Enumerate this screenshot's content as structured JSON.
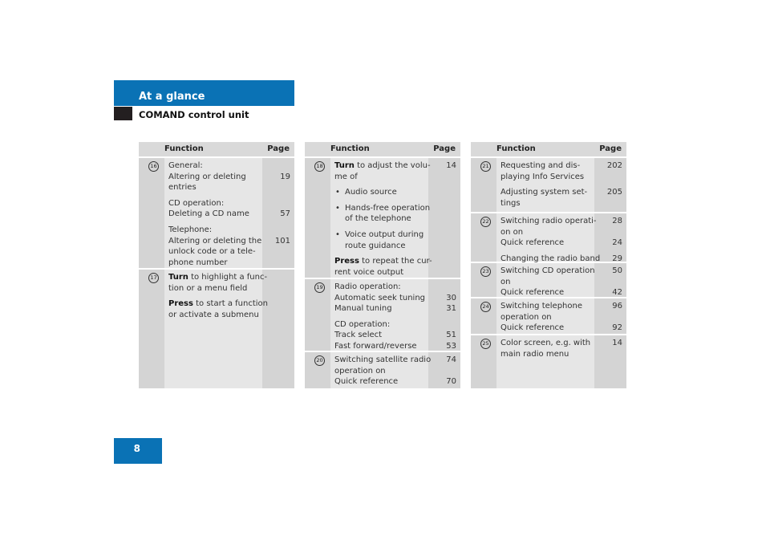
{
  "header": {
    "section": "At a glance",
    "subtitle": "COMAND control unit",
    "page_number": "8"
  },
  "tables": [
    {
      "head": {
        "function": "Function",
        "page": "Page"
      },
      "rows": [
        {
          "num": "16",
          "h": 137,
          "paras": [
            [
              {
                "t": "General:"
              },
              {
                "t": "Altering or deleting",
                "p": "19"
              },
              {
                "t": "entries"
              }
            ],
            [
              {
                "t": "CD operation:"
              },
              {
                "t": "Deleting a CD name",
                "p": "57"
              }
            ],
            [
              {
                "t": "Telephone:"
              },
              {
                "t": "Altering or deleting the",
                "p": "101"
              },
              {
                "t": "unlock code or a tele-"
              },
              {
                "t": "phone number"
              }
            ]
          ]
        },
        {
          "num": "17",
          "h": 148,
          "paras": [
            [
              {
                "b": "Turn",
                "t": " to highlight a func-"
              },
              {
                "t": "tion or a menu field"
              }
            ],
            [
              {
                "b": "Press",
                "t": " to start a function"
              },
              {
                "t": "or activate a submenu"
              }
            ]
          ]
        }
      ]
    },
    {
      "head": {
        "function": "Function",
        "page": "Page"
      },
      "rows": [
        {
          "num": "18",
          "h": 149,
          "paras": [
            [
              {
                "b": "Turn",
                "t": " to adjust the volu-",
                "p": "14"
              },
              {
                "t": "me of"
              }
            ],
            [
              {
                "t": "Audio source",
                "bullet": true
              }
            ],
            [
              {
                "t": "Hands-free operation",
                "bullet": true
              },
              {
                "t": "of the telephone",
                "cont": true
              }
            ],
            [
              {
                "t": "Voice output during",
                "bullet": true
              },
              {
                "t": "route guidance",
                "cont": true
              }
            ],
            [
              {
                "b": "Press",
                "t": " to repeat the cur-"
              },
              {
                "t": "rent voice output"
              }
            ]
          ]
        },
        {
          "num": "19",
          "h": 89,
          "paras": [
            [
              {
                "t": "Radio operation:"
              },
              {
                "t": "Automatic seek tuning",
                "p": "30"
              },
              {
                "t": "Manual tuning",
                "p": "31"
              }
            ],
            [
              {
                "t": "CD operation:"
              },
              {
                "t": "Track select",
                "p": "51"
              },
              {
                "t": "Fast forward/reverse",
                "p": "53"
              }
            ]
          ]
        },
        {
          "num": "20",
          "h": 45,
          "paras": [
            [
              {
                "t": "Switching satellite radio",
                "p": "74"
              },
              {
                "t": "operation on"
              },
              {
                "t": "Quick reference",
                "p": "70"
              }
            ]
          ]
        }
      ]
    },
    {
      "head": {
        "function": "Function",
        "page": "Page"
      },
      "rows": [
        {
          "num": "21",
          "h": 67,
          "paras": [
            [
              {
                "t": "Requesting and dis-",
                "p": "202"
              },
              {
                "t": "playing Info Services"
              }
            ],
            [
              {
                "t": "Adjusting system set-",
                "p": "205"
              },
              {
                "t": "tings"
              }
            ]
          ]
        },
        {
          "num": "22",
          "h": 60,
          "paras": [
            [
              {
                "t": "Switching radio operati-",
                "p": "28"
              },
              {
                "t": "on on"
              },
              {
                "t": "Quick reference",
                "p": "24"
              }
            ],
            [
              {
                "t": "Changing the radio band",
                "p": "29"
              }
            ]
          ]
        },
        {
          "num": "23",
          "h": 42,
          "paras": [
            [
              {
                "t": "Switching CD operation",
                "p": "50"
              },
              {
                "t": "on"
              },
              {
                "t": "Quick reference",
                "p": "42"
              }
            ]
          ]
        },
        {
          "num": "24",
          "h": 44,
          "paras": [
            [
              {
                "t": "Switching telephone",
                "p": "96"
              },
              {
                "t": "operation on"
              },
              {
                "t": "Quick reference",
                "p": "92"
              }
            ]
          ]
        },
        {
          "num": "25",
          "h": 66,
          "paras": [
            [
              {
                "t": "Color screen, e.g. with",
                "p": "14"
              },
              {
                "t": "main radio menu"
              }
            ]
          ]
        }
      ]
    }
  ],
  "colors": {
    "brand_blue": "#0a72b5",
    "header_gray": "#d9d9d9",
    "cell_gray": "#e6e6e6",
    "side_gray": "#d4d4d4"
  }
}
